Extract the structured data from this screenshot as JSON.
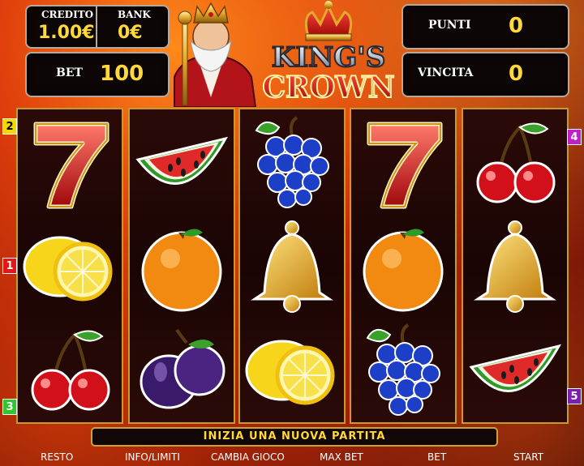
{
  "header": {
    "credito_label": "CREDITO",
    "credito_value": "1.00€",
    "bank_label": "BANK",
    "bank_value": "0€",
    "bet_label": "BET",
    "bet_value": "100",
    "punti_label": "PUNTI",
    "punti_value": "0",
    "vincita_label": "VINCITA",
    "vincita_value": "0"
  },
  "logo": {
    "line1": "KING'S",
    "line2": "CROWN"
  },
  "reels": [
    [
      "seven",
      "lemon",
      "cherry"
    ],
    [
      "watermelon",
      "orange",
      "plum"
    ],
    [
      "grapes",
      "bell",
      "lemon"
    ],
    [
      "seven",
      "orange",
      "grapes"
    ],
    [
      "cherry",
      "bell",
      "watermelon"
    ]
  ],
  "paylines": {
    "left": [
      "2",
      "1",
      "3"
    ],
    "right": [
      "4",
      "5"
    ]
  },
  "message": "INIZIA UNA NUOVA PARTITA",
  "buttons": {
    "resto": "RESTO",
    "info": "INFO/LIMITI",
    "cambia": "CAMBIA GIOCO",
    "maxbet": "MAX BET",
    "bet": "BET",
    "start": "START"
  },
  "colors": {
    "value_yellow": "#ffd83a",
    "payline_2": "#f5d800",
    "payline_1": "#e01818",
    "payline_3": "#2ec82e",
    "payline_4": "#c020c8",
    "payline_5": "#7a1fb0"
  }
}
